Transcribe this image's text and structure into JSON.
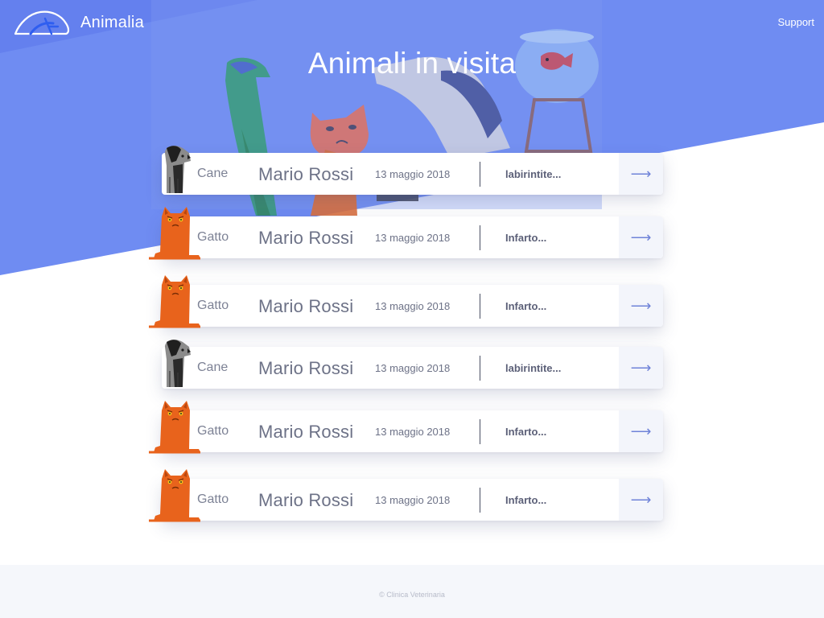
{
  "header": {
    "app_name": "Animalia",
    "support_label": "Support"
  },
  "hero": {
    "title": "Animali in visita"
  },
  "visits": [
    {
      "species": "Cane",
      "animal": "dog",
      "owner": "Mario Rossi",
      "date": "13 maggio 2018",
      "diagnosis": "labirintite...",
      "action_icon": "arrow-right-icon"
    },
    {
      "species": "Gatto",
      "animal": "cat",
      "owner": "Mario Rossi",
      "date": "13 maggio 2018",
      "diagnosis": "Infarto...",
      "action_icon": "arrow-right-icon"
    },
    {
      "species": "Gatto",
      "animal": "cat",
      "owner": "Mario Rossi",
      "date": "13 maggio 2018",
      "diagnosis": "Infarto...",
      "action_icon": "arrow-right-icon"
    },
    {
      "species": "Cane",
      "animal": "dog",
      "owner": "Mario Rossi",
      "date": "13 maggio 2018",
      "diagnosis": "labirintite...",
      "action_icon": "arrow-right-icon"
    },
    {
      "species": "Gatto",
      "animal": "cat",
      "owner": "Mario Rossi",
      "date": "13 maggio 2018",
      "diagnosis": "Infarto...",
      "action_icon": "arrow-right-icon"
    },
    {
      "species": "Gatto",
      "animal": "cat",
      "owner": "Mario Rossi",
      "date": "13 maggio 2018",
      "diagnosis": "Infarto...",
      "action_icon": "arrow-right-icon"
    }
  ],
  "footer": {
    "copyright": "© Clinica Veterinaria"
  },
  "colors": {
    "hero_blue": "#6f8cf2",
    "hero_blue_dark": "#6480ee",
    "accent": "#6f83d8",
    "cat_orange": "#e8631c",
    "footer_bg": "#f5f7fb"
  }
}
